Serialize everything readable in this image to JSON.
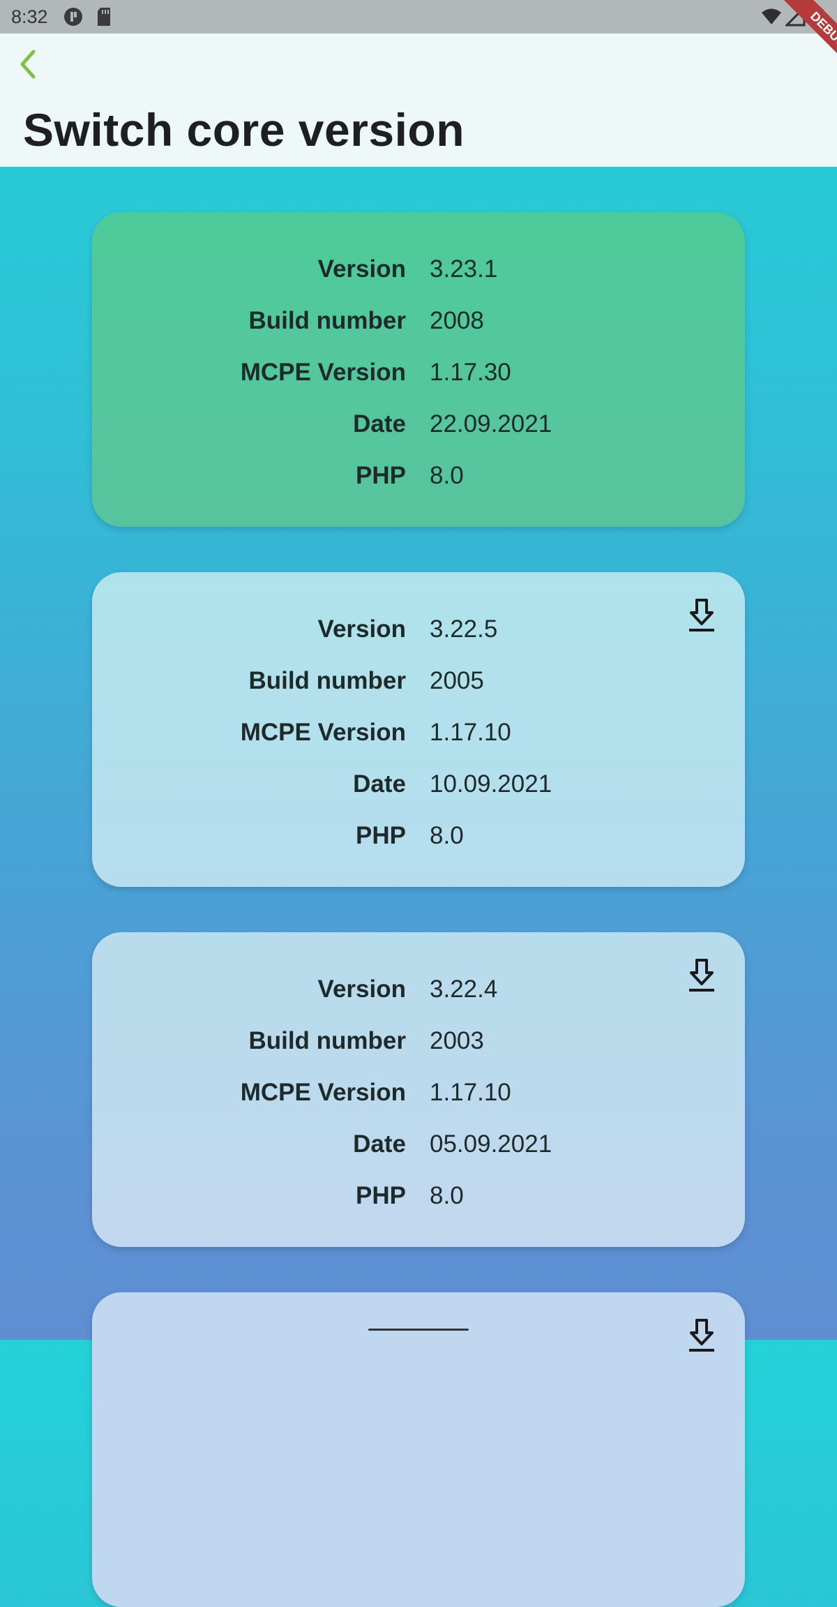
{
  "status_bar": {
    "time": "8:32",
    "icons": [
      "app-icon",
      "sd-card-icon",
      "wifi-icon",
      "signal-icon",
      "battery-icon"
    ]
  },
  "app_bar": {
    "back_icon": "chevron-left-icon",
    "title": "Switch core version",
    "debug_banner": "DEBUG"
  },
  "colors": {
    "accent_back": "#7dc142",
    "active_card": "#4ecb9b",
    "inactive_card": "#b6ddee"
  },
  "labels": {
    "version": "Version",
    "build_number": "Build number",
    "mcpe_version": "MCPE Version",
    "date": "Date",
    "php": "PHP"
  },
  "versions": [
    {
      "version": "3.23.1",
      "build": "2008",
      "mcpe": "1.17.30",
      "date": "22.09.2021",
      "php": "8.0",
      "active": true
    },
    {
      "version": "3.22.5",
      "build": "2005",
      "mcpe": "1.17.10",
      "date": "10.09.2021",
      "php": "8.0",
      "active": false
    },
    {
      "version": "3.22.4",
      "build": "2003",
      "mcpe": "1.17.10",
      "date": "05.09.2021",
      "php": "8.0",
      "active": false
    }
  ]
}
